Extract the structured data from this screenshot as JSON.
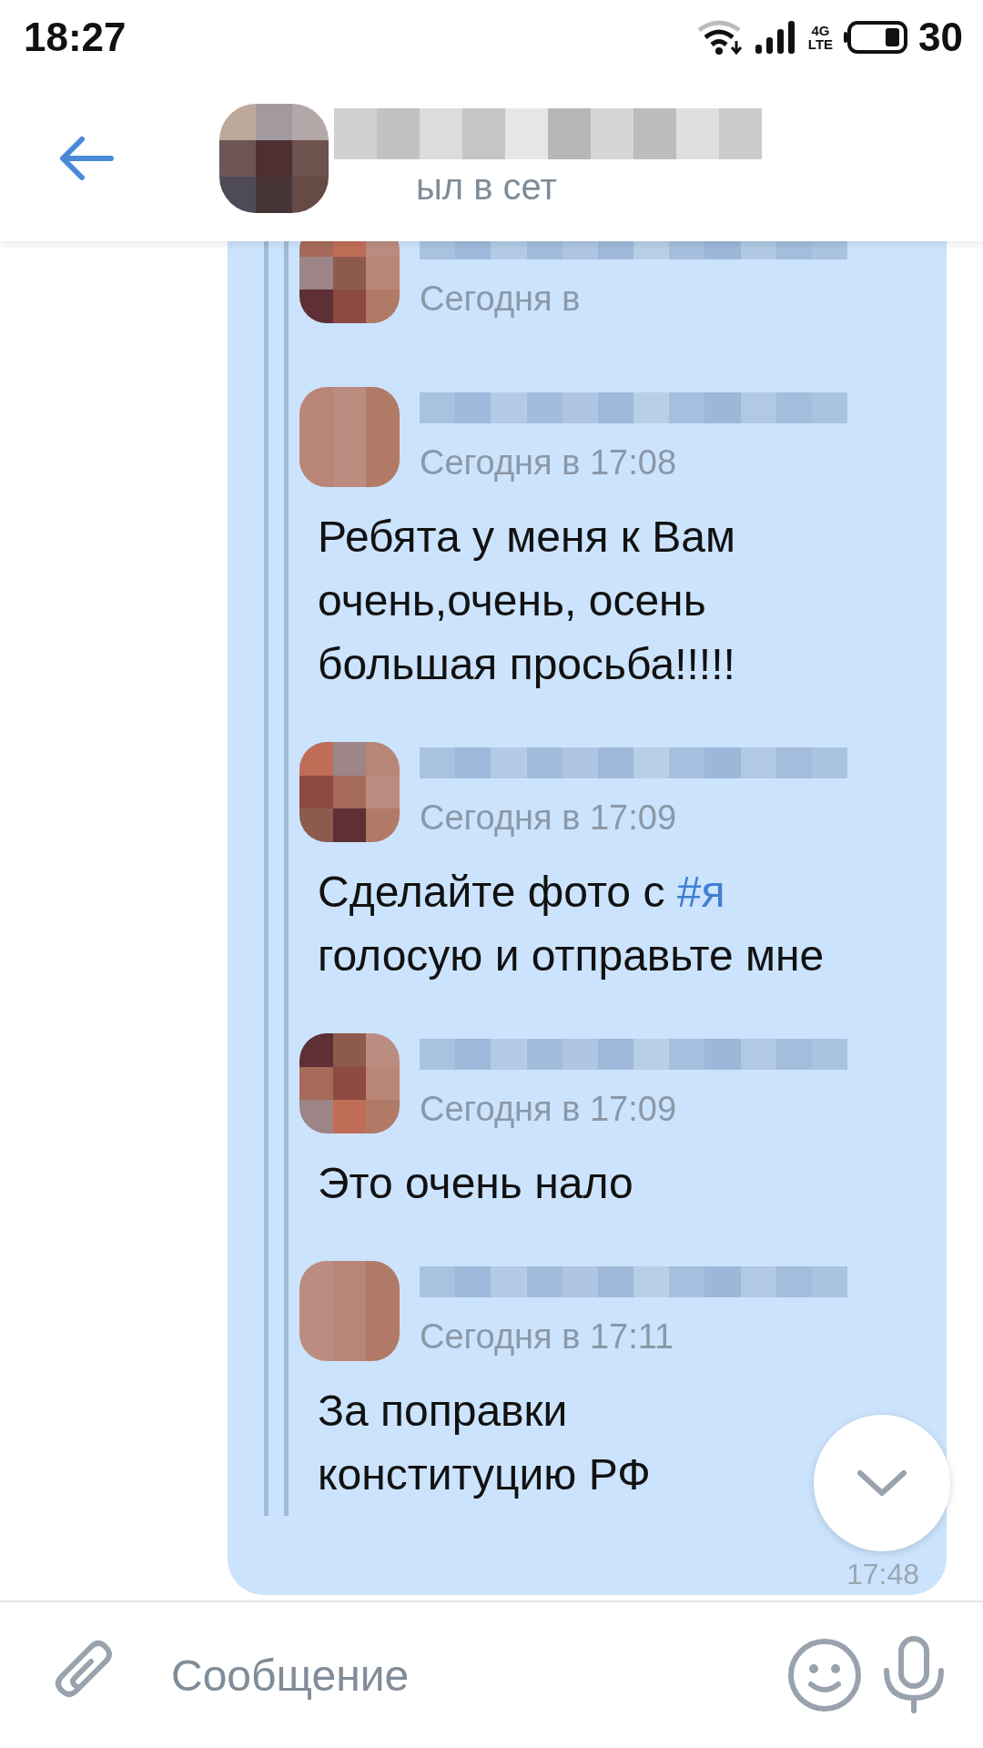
{
  "status_bar": {
    "time": "18:27",
    "network": "4G",
    "network_sub": "LTE",
    "battery": "30"
  },
  "header": {
    "status_text": "ыл в сет"
  },
  "quotes": [
    {
      "time": "Сегодня в"
    },
    {
      "time": "Сегодня в 17:08",
      "lines": [
        [
          {
            "kind": "plain",
            "text": "Ребята у меня к Вам"
          }
        ],
        [
          {
            "kind": "plain",
            "text": "очень,очень, осень"
          }
        ],
        [
          {
            "kind": "plain",
            "text": "большая просьба!!!!!"
          }
        ]
      ]
    },
    {
      "time": "Сегодня в 17:09",
      "lines": [
        [
          {
            "kind": "plain",
            "text": "Сделайте фото с "
          },
          {
            "kind": "hashtag",
            "text": "#я"
          }
        ],
        [
          {
            "kind": "plain",
            "text": "голосую и отправьте мне"
          }
        ]
      ]
    },
    {
      "time": "Сегодня в 17:09",
      "lines": [
        [
          {
            "kind": "plain",
            "text": "Это очень нало"
          }
        ]
      ]
    },
    {
      "time": "Сегодня в 17:11",
      "lines": [
        [
          {
            "kind": "plain",
            "text": "За поправки"
          }
        ],
        [
          {
            "kind": "plain",
            "text": "конституцию РФ"
          }
        ]
      ]
    }
  ],
  "message_time": "17:48",
  "composer": {
    "placeholder": "Сообщение"
  }
}
